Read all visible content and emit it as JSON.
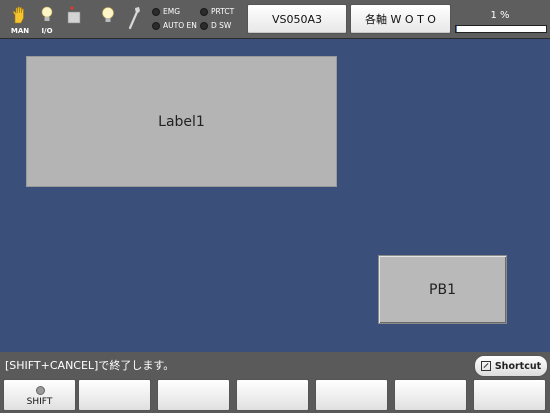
{
  "top_icons": [
    {
      "name": "hand-icon",
      "caption": "MAN"
    },
    {
      "name": "bulb-icon",
      "caption": "I/O"
    },
    {
      "name": "stop-icon",
      "caption": ""
    },
    {
      "name": "lamp-icon",
      "caption": ""
    },
    {
      "name": "wrench-icon",
      "caption": ""
    }
  ],
  "status": {
    "emg": "EMG",
    "prtct": "PRTCT",
    "auto_en": "AUTO EN",
    "d_sw": "D SW"
  },
  "toolbar": {
    "model": "VS050A3",
    "axes": "各軸 W O T O",
    "percent_label": "1 %",
    "percent_value": 1
  },
  "main": {
    "label1": "Label1",
    "pb1": "PB1"
  },
  "message": "[SHIFT+CANCEL]で終了します。",
  "shortcut": "Shortcut",
  "function_keys": [
    "SHIFT",
    "",
    "",
    "",
    "",
    "",
    ""
  ],
  "colors": {
    "background": "#3a4f7a",
    "toolbar": "#5e5e5e",
    "progress": "#4a7acb"
  }
}
